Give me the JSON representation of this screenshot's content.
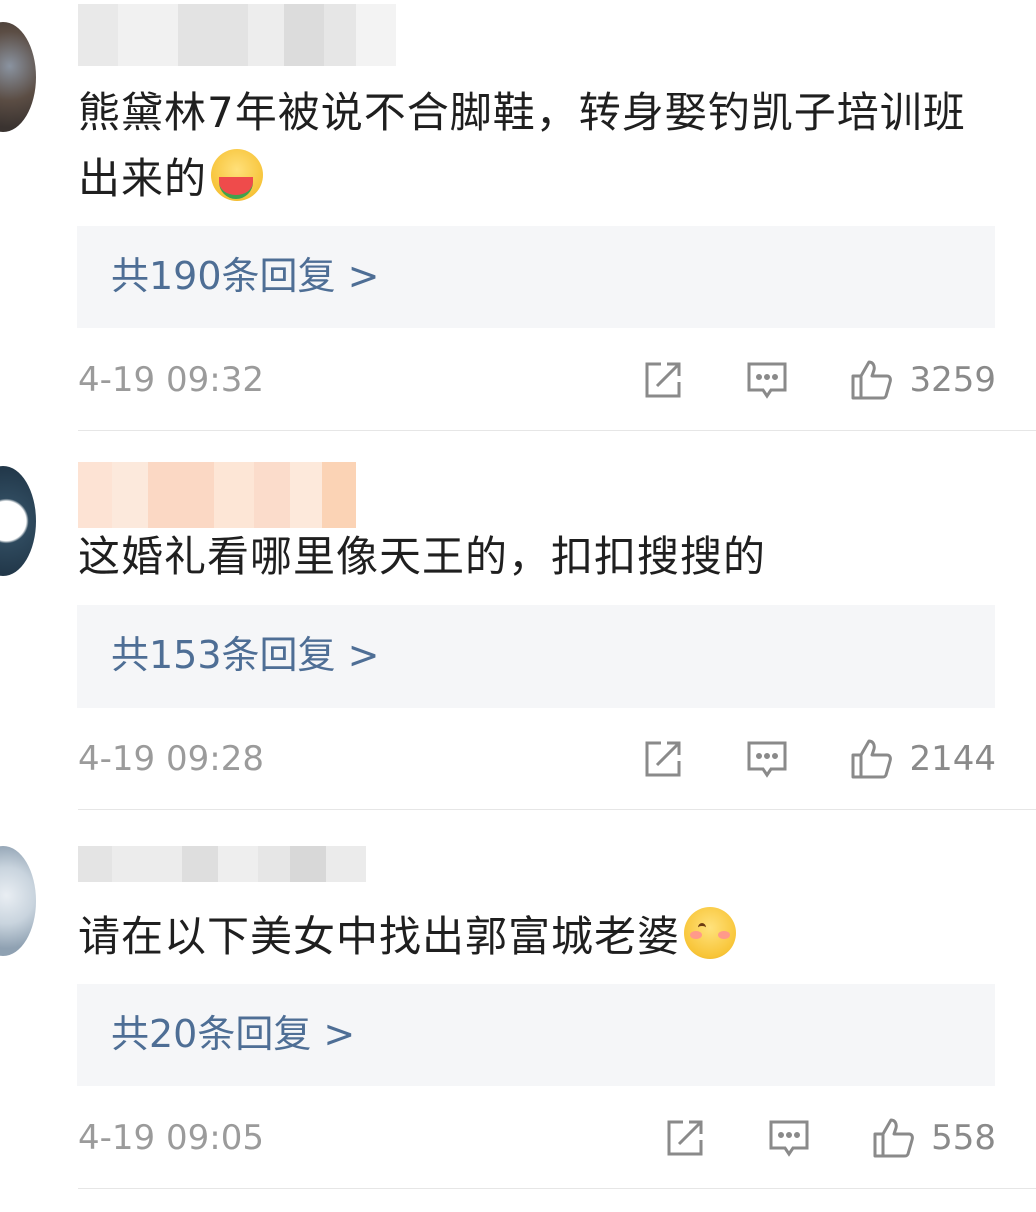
{
  "comments": [
    {
      "text": "熊黛林7年被说不合脚鞋，转身娶钓凯子培训班出来的",
      "emoji": "watermelon-face-emoji",
      "replies_label": "共190条回复 >",
      "time": "4-19 09:32",
      "likes": "3259"
    },
    {
      "text": "这婚礼看哪里像天王的，扣扣搜搜的",
      "emoji": "",
      "replies_label": "共153条回复 >",
      "time": "4-19 09:28",
      "likes": "2144"
    },
    {
      "text": "请在以下美女中找出郭富城老婆",
      "emoji": "blushing-smile-emoji",
      "replies_label": "共20条回复 >",
      "time": "4-19 09:05",
      "likes": "558"
    }
  ],
  "colors": {
    "link": "#4e6e95",
    "meta": "#9b9b9b",
    "reply_bg": "#f5f6f8"
  },
  "icons": {
    "share": "share-icon",
    "comment": "comment-icon",
    "like": "thumbs-up-icon"
  }
}
